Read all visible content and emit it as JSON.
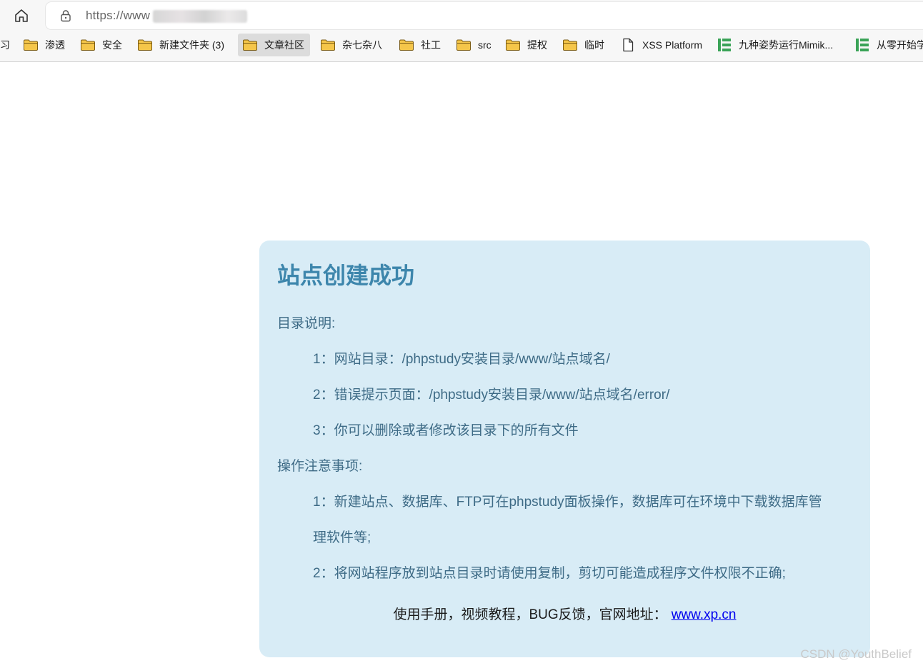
{
  "browser": {
    "url": "https://www",
    "bookmarks": [
      {
        "label": "习",
        "icon": "none",
        "active": false
      },
      {
        "label": "渗透",
        "icon": "folder-icon",
        "active": false
      },
      {
        "label": "安全",
        "icon": "folder-icon",
        "active": false
      },
      {
        "label": "新建文件夹 (3)",
        "icon": "folder-icon",
        "active": false
      },
      {
        "label": "文章社区",
        "icon": "folder-icon",
        "active": true
      },
      {
        "label": "杂七杂八",
        "icon": "folder-icon",
        "active": false
      },
      {
        "label": "社工",
        "icon": "folder-icon",
        "active": false
      },
      {
        "label": "src",
        "icon": "folder-icon",
        "active": false
      },
      {
        "label": "提权",
        "icon": "folder-icon",
        "active": false
      },
      {
        "label": "临时",
        "icon": "folder-icon",
        "active": false
      },
      {
        "label": "XSS Platform",
        "icon": "page-icon",
        "active": false
      },
      {
        "label": "九种姿势运行Mimik...",
        "icon": "site-logo-icon",
        "active": false
      },
      {
        "label": "从零开始学",
        "icon": "site-logo-icon",
        "active": false
      }
    ]
  },
  "page": {
    "title": "站点创建成功",
    "dir_heading": "目录说明:",
    "dir_items": [
      "1：网站目录：/phpstudy安装目录/www/站点域名/",
      "2：错误提示页面：/phpstudy安装目录/www/站点域名/error/",
      "3：你可以删除或者修改该目录下的所有文件"
    ],
    "notes_heading": "操作注意事项:",
    "notes_items": [
      "1：新建站点、数据库、FTP可在phpstudy面板操作，数据库可在环境中下载数据库管",
      "理软件等;",
      "2：将网站程序放到站点目录时请使用复制，剪切可能造成程序文件权限不正确;"
    ],
    "footer_text": "使用手册，视频教程，BUG反馈，官网地址：",
    "footer_link": "www.xp.cn"
  },
  "watermark": "CSDN @YouthBelief",
  "colors": {
    "card_bg": "#d8ecf6",
    "title": "#3d86ac",
    "body_text": "#3e6b86",
    "link": "#0000ee",
    "folder": "#f5c64a"
  }
}
